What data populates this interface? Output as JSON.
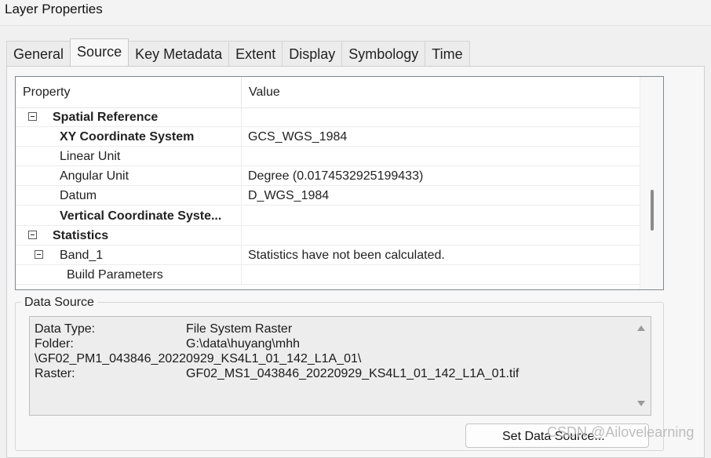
{
  "window": {
    "title": "Layer Properties"
  },
  "tabs": [
    {
      "label": "General"
    },
    {
      "label": "Source"
    },
    {
      "label": "Key Metadata"
    },
    {
      "label": "Extent"
    },
    {
      "label": "Display"
    },
    {
      "label": "Symbology"
    },
    {
      "label": "Time"
    }
  ],
  "active_tab": "Source",
  "grid": {
    "columns": {
      "property": "Property",
      "value": "Value"
    },
    "rows": [
      {
        "label": "Spatial Reference",
        "value": "",
        "bold": true,
        "expander": true
      },
      {
        "label": "XY Coordinate System",
        "value": "GCS_WGS_1984",
        "bold": true
      },
      {
        "label": "Linear Unit",
        "value": ""
      },
      {
        "label": "Angular Unit",
        "value": "Degree (0.0174532925199433)"
      },
      {
        "label": "Datum",
        "value": "D_WGS_1984"
      },
      {
        "label": "Vertical Coordinate Syste...",
        "value": "",
        "bold": true
      },
      {
        "label": "Statistics",
        "value": "",
        "bold": true,
        "expander": true
      },
      {
        "label": "Band_1",
        "value": "Statistics have not been calculated.",
        "expander": true
      },
      {
        "label": "Build Parameters",
        "value": ""
      }
    ]
  },
  "data_source": {
    "group_title": "Data Source",
    "lines": [
      {
        "label": "Data Type:",
        "value": "File System Raster"
      },
      {
        "label": "Folder:",
        "value": "G:\\data\\huyang\\mhh"
      },
      {
        "label": "\\GF02_PM1_043846_20220929_KS4L1_01_142_L1A_01\\",
        "value": ""
      },
      {
        "label": "Raster:",
        "value": "GF02_MS1_043846_20220929_KS4L1_01_142_L1A_01.tif"
      }
    ]
  },
  "buttons": {
    "set_data_source": "Set Data Source..."
  },
  "watermark": "CSDN @Ailovelearning"
}
